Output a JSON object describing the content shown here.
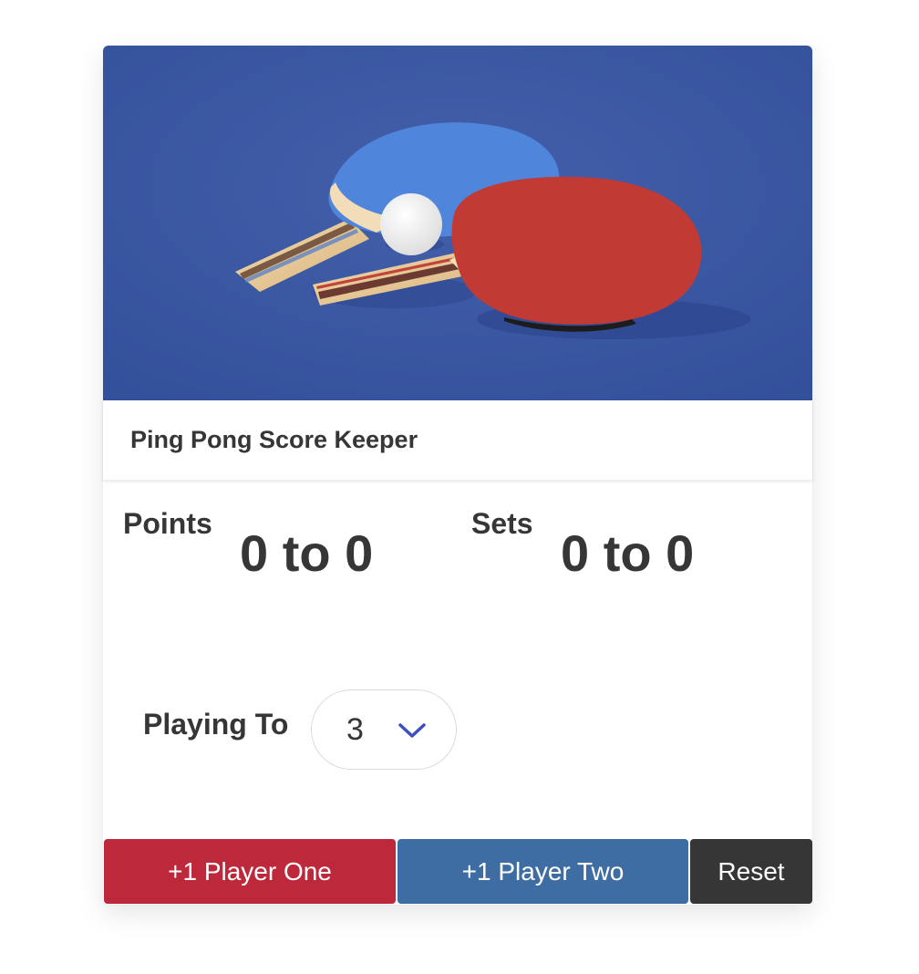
{
  "card": {
    "title": "Ping Pong Score Keeper",
    "image_alt": "Ping pong paddles and ball on a blue table"
  },
  "points": {
    "label": "Points",
    "player_one": 0,
    "player_two": 0,
    "separator": "to"
  },
  "sets": {
    "label": "Sets",
    "player_one": 0,
    "player_two": 0,
    "separator": "to"
  },
  "playing_to": {
    "label": "Playing To",
    "selected": "3"
  },
  "buttons": {
    "player_one": "+1 Player One",
    "player_two": "+1 Player Two",
    "reset": "Reset"
  },
  "colors": {
    "player_one": "#be283b",
    "player_two": "#3d6da3",
    "reset": "#363636",
    "accent_chevron": "#3e4fc2",
    "table_blue": "#3a55a0"
  }
}
